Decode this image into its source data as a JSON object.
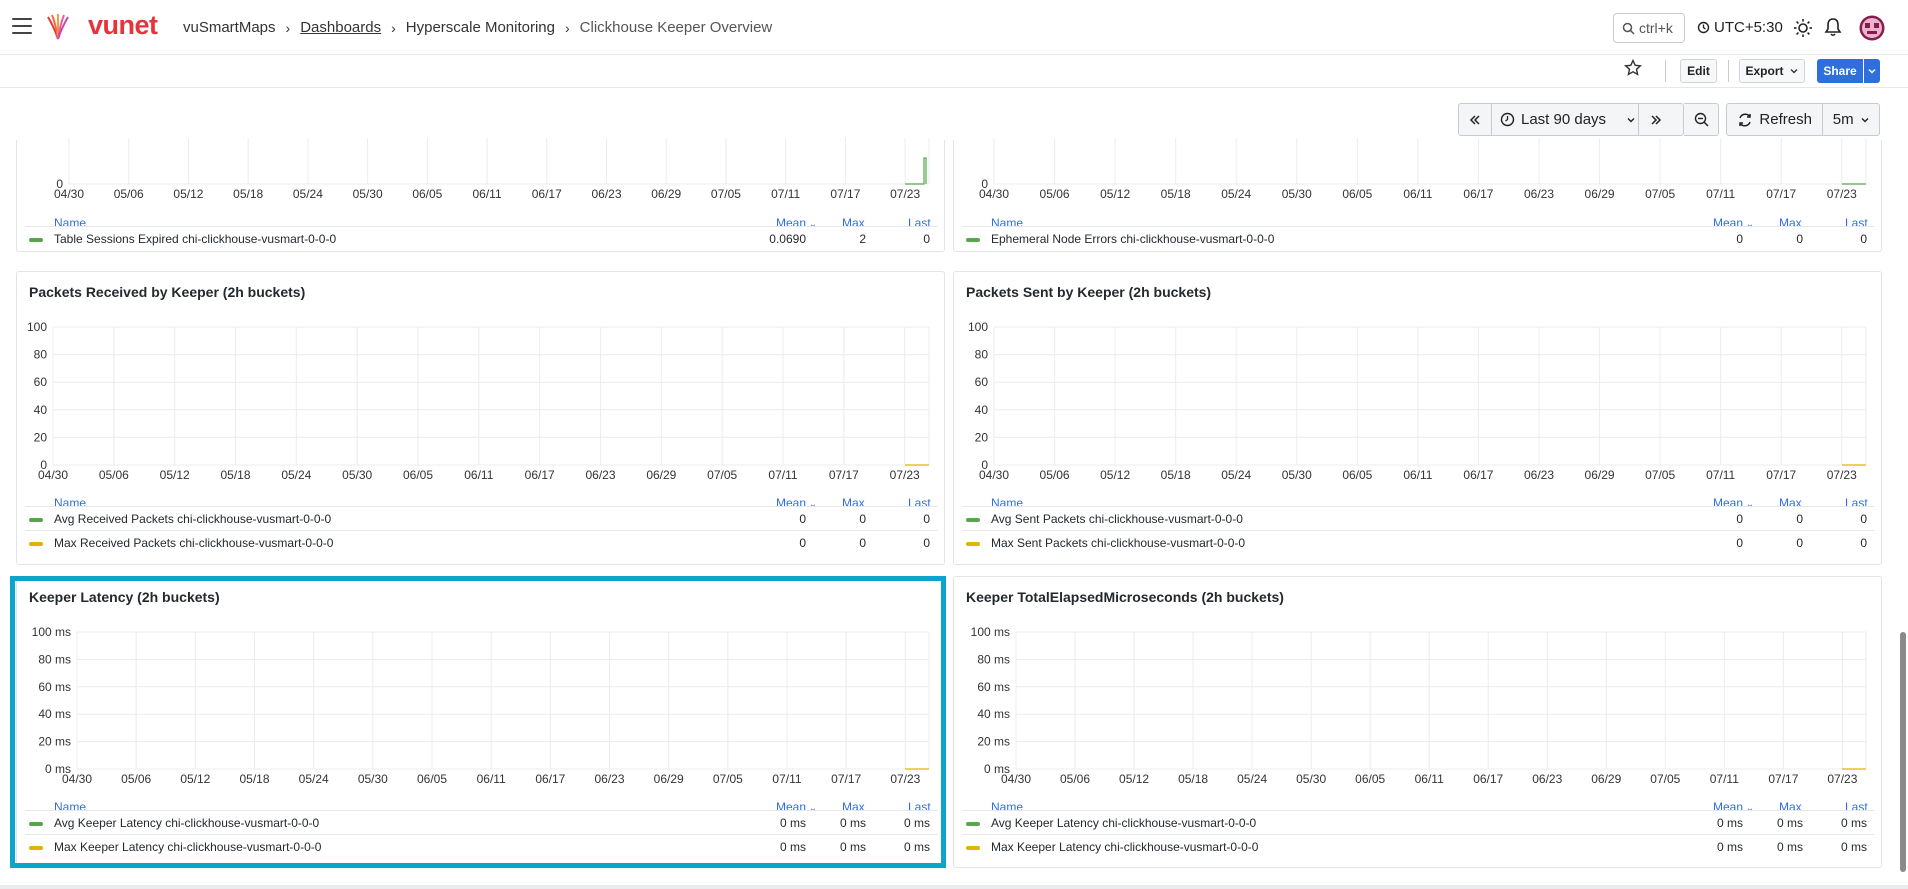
{
  "brand": {
    "name": "vunet"
  },
  "breadcrumb": [
    "vuSmartMaps",
    "Dashboards",
    "Hyperscale Monitoring",
    "Clickhouse Keeper Overview"
  ],
  "search": {
    "label": "ctrl+k"
  },
  "timezone": "UTC+5:30",
  "toolbar": {
    "edit": "Edit",
    "export": "Export",
    "share": "Share"
  },
  "timepicker": {
    "range": "Last 90 days",
    "refresh": "Refresh",
    "interval": "5m"
  },
  "x_ticks": [
    "04/30",
    "05/06",
    "05/12",
    "05/18",
    "05/24",
    "05/30",
    "06/05",
    "06/11",
    "06/17",
    "06/23",
    "06/29",
    "07/05",
    "07/11",
    "07/17",
    "07/23"
  ],
  "legend_headers": {
    "name": "Name",
    "mean": "Mean",
    "max": "Max",
    "last": "Last"
  },
  "colors": {
    "green": "#56a64b",
    "yellow": "#e0b400",
    "accent": "#2f6fdd",
    "highlight": "#0aa5c8"
  },
  "panels": [
    {
      "id": "table-sessions",
      "title": "",
      "y_ticks": [
        "0"
      ],
      "rows": [
        {
          "name": "Table Sessions Expired chi-clickhouse-vusmart-0-0-0",
          "color": "#56a64b",
          "mean": "0.0690",
          "max": "2",
          "last": "0"
        }
      ]
    },
    {
      "id": "ephemeral",
      "title": "",
      "y_ticks": [
        "0"
      ],
      "rows": [
        {
          "name": "Ephemeral Node Errors chi-clickhouse-vusmart-0-0-0",
          "color": "#56a64b",
          "mean": "0",
          "max": "0",
          "last": "0"
        }
      ]
    },
    {
      "id": "packets-received",
      "title": "Packets Received by Keeper (2h buckets)",
      "y_ticks": [
        "100",
        "80",
        "60",
        "40",
        "20",
        "0"
      ],
      "rows": [
        {
          "name": "Avg Received Packets chi-clickhouse-vusmart-0-0-0",
          "color": "#56a64b",
          "mean": "0",
          "max": "0",
          "last": "0"
        },
        {
          "name": "Max Received Packets chi-clickhouse-vusmart-0-0-0",
          "color": "#e0b400",
          "mean": "0",
          "max": "0",
          "last": "0"
        }
      ]
    },
    {
      "id": "packets-sent",
      "title": "Packets Sent by Keeper (2h buckets)",
      "y_ticks": [
        "100",
        "80",
        "60",
        "40",
        "20",
        "0"
      ],
      "rows": [
        {
          "name": "Avg Sent Packets chi-clickhouse-vusmart-0-0-0",
          "color": "#56a64b",
          "mean": "0",
          "max": "0",
          "last": "0"
        },
        {
          "name": "Max Sent Packets chi-clickhouse-vusmart-0-0-0",
          "color": "#e0b400",
          "mean": "0",
          "max": "0",
          "last": "0"
        }
      ]
    },
    {
      "id": "keeper-latency",
      "title": "Keeper Latency (2h buckets)",
      "y_ticks": [
        "100 ms",
        "80 ms",
        "60 ms",
        "40 ms",
        "20 ms",
        "0 ms"
      ],
      "rows": [
        {
          "name": "Avg Keeper Latency chi-clickhouse-vusmart-0-0-0",
          "color": "#56a64b",
          "mean": "0 ms",
          "max": "0 ms",
          "last": "0 ms"
        },
        {
          "name": "Max Keeper Latency chi-clickhouse-vusmart-0-0-0",
          "color": "#e0b400",
          "mean": "0 ms",
          "max": "0 ms",
          "last": "0 ms"
        }
      ]
    },
    {
      "id": "keeper-elapsed",
      "title": "Keeper TotalElapsedMicroseconds (2h buckets)",
      "y_ticks": [
        "100 ms",
        "80 ms",
        "60 ms",
        "40 ms",
        "20 ms",
        "0 ms"
      ],
      "rows": [
        {
          "name": "Avg Keeper Latency chi-clickhouse-vusmart-0-0-0",
          "color": "#56a64b",
          "mean": "0 ms",
          "max": "0 ms",
          "last": "0 ms"
        },
        {
          "name": "Max Keeper Latency chi-clickhouse-vusmart-0-0-0",
          "color": "#e0b400",
          "mean": "0 ms",
          "max": "0 ms",
          "last": "0 ms"
        }
      ]
    }
  ]
}
